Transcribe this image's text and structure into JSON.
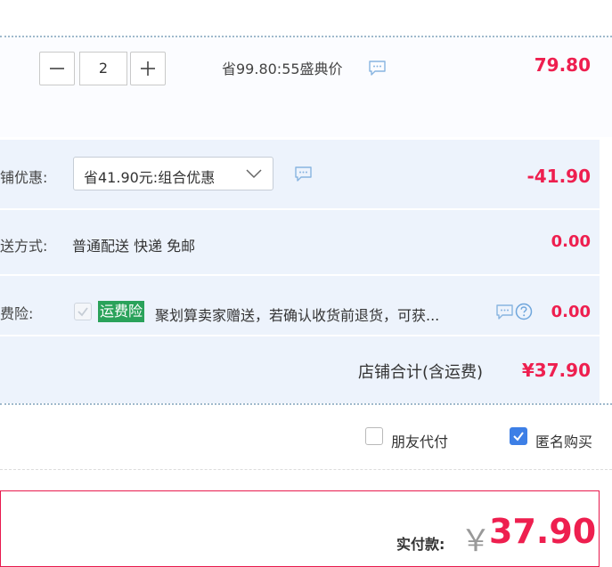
{
  "item": {
    "quantity": "2",
    "promo_text": "省99.80:55盛典价",
    "price": "79.80",
    "decrement_icon": "minus-icon",
    "increment_icon": "plus-icon",
    "message_icon": "chat-bubble-icon"
  },
  "discount": {
    "label": "铺优惠:",
    "selected": "省41.90元:组合优惠",
    "amount": "-41.90"
  },
  "shipping": {
    "label": "送方式:",
    "method": "普通配送 快递 免邮",
    "amount": "0.00"
  },
  "insurance": {
    "label": "费险:",
    "checked": true,
    "tag": "运费险",
    "text": "聚划算卖家赠送，若确认收货前退货，可获...",
    "amount": "0.00",
    "help_icon": "question-circle-icon"
  },
  "store_total": {
    "label": "店铺合计(含运费)",
    "amount": "¥37.90"
  },
  "options": {
    "friend_pay_label": "朋友代付",
    "friend_pay_checked": false,
    "anonymous_label": "匿名购买",
    "anonymous_checked": true
  },
  "payment": {
    "label": "实付款:",
    "currency": "￥",
    "amount": "37.90"
  },
  "colors": {
    "price_red": "#ee1f4f",
    "tag_green": "#2aa25a",
    "checkbox_blue": "#3d7fe6",
    "panel_bg": "#edf3fc"
  }
}
